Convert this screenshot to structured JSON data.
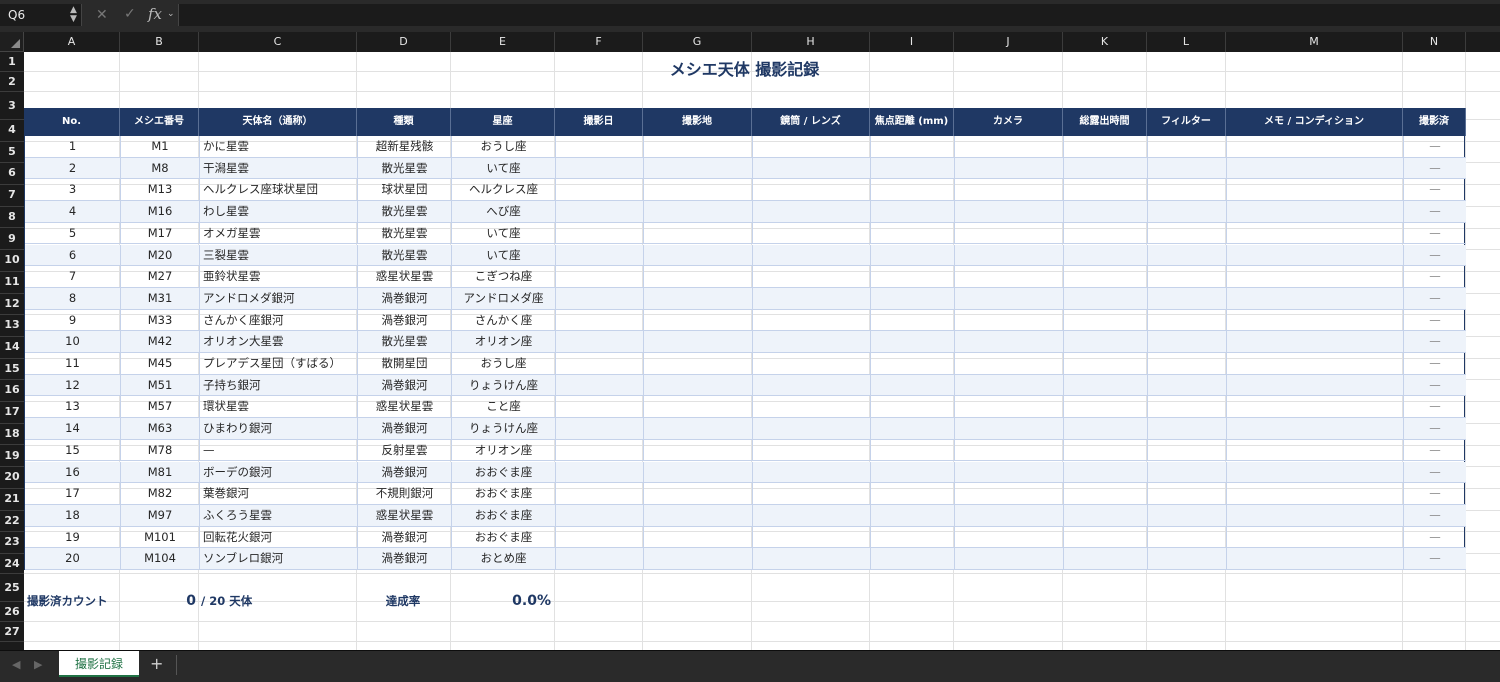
{
  "formula_bar": {
    "name_box": "Q6",
    "fx_label": "fx",
    "formula": ""
  },
  "columns": [
    "A",
    "B",
    "C",
    "D",
    "E",
    "F",
    "G",
    "H",
    "I",
    "J",
    "K",
    "L",
    "M",
    "N"
  ],
  "rows": [
    "1",
    "2",
    "3",
    "4",
    "5",
    "6",
    "7",
    "8",
    "9",
    "10",
    "11",
    "12",
    "13",
    "14",
    "15",
    "16",
    "17",
    "18",
    "19",
    "20",
    "21",
    "22",
    "23",
    "24",
    "25",
    "26",
    "27"
  ],
  "title": "メシエ天体 撮影記録",
  "headers": [
    "No.",
    "メシエ番号",
    "天体名（通称）",
    "種類",
    "星座",
    "撮影日",
    "撮影地",
    "鏡筒 / レンズ",
    "焦点距離 (mm)",
    "カメラ",
    "総露出時間",
    "フィルター",
    "メモ / コンディション",
    "撮影済"
  ],
  "records": [
    {
      "no": "1",
      "messier": "M1",
      "name": "かに星雲",
      "type": "超新星残骸",
      "constellation": "おうし座",
      "done": "—"
    },
    {
      "no": "2",
      "messier": "M8",
      "name": "干潟星雲",
      "type": "散光星雲",
      "constellation": "いて座",
      "done": "—"
    },
    {
      "no": "3",
      "messier": "M13",
      "name": "ヘルクレス座球状星団",
      "type": "球状星団",
      "constellation": "ヘルクレス座",
      "done": "—"
    },
    {
      "no": "4",
      "messier": "M16",
      "name": "わし星雲",
      "type": "散光星雲",
      "constellation": "へび座",
      "done": "—"
    },
    {
      "no": "5",
      "messier": "M17",
      "name": "オメガ星雲",
      "type": "散光星雲",
      "constellation": "いて座",
      "done": "—"
    },
    {
      "no": "6",
      "messier": "M20",
      "name": "三裂星雲",
      "type": "散光星雲",
      "constellation": "いて座",
      "done": "—"
    },
    {
      "no": "7",
      "messier": "M27",
      "name": "亜鈴状星雲",
      "type": "惑星状星雲",
      "constellation": "こぎつね座",
      "done": "—"
    },
    {
      "no": "8",
      "messier": "M31",
      "name": "アンドロメダ銀河",
      "type": "渦巻銀河",
      "constellation": "アンドロメダ座",
      "done": "—"
    },
    {
      "no": "9",
      "messier": "M33",
      "name": "さんかく座銀河",
      "type": "渦巻銀河",
      "constellation": "さんかく座",
      "done": "—"
    },
    {
      "no": "10",
      "messier": "M42",
      "name": "オリオン大星雲",
      "type": "散光星雲",
      "constellation": "オリオン座",
      "done": "—"
    },
    {
      "no": "11",
      "messier": "M45",
      "name": "プレアデス星団（すばる）",
      "type": "散開星団",
      "constellation": "おうし座",
      "done": "—"
    },
    {
      "no": "12",
      "messier": "M51",
      "name": "子持ち銀河",
      "type": "渦巻銀河",
      "constellation": "りょうけん座",
      "done": "—"
    },
    {
      "no": "13",
      "messier": "M57",
      "name": "環状星雲",
      "type": "惑星状星雲",
      "constellation": "こと座",
      "done": "—"
    },
    {
      "no": "14",
      "messier": "M63",
      "name": "ひまわり銀河",
      "type": "渦巻銀河",
      "constellation": "りょうけん座",
      "done": "—"
    },
    {
      "no": "15",
      "messier": "M78",
      "name": "—",
      "type": "反射星雲",
      "constellation": "オリオン座",
      "done": "—"
    },
    {
      "no": "16",
      "messier": "M81",
      "name": "ボーデの銀河",
      "type": "渦巻銀河",
      "constellation": "おおぐま座",
      "done": "—"
    },
    {
      "no": "17",
      "messier": "M82",
      "name": "葉巻銀河",
      "type": "不規則銀河",
      "constellation": "おおぐま座",
      "done": "—"
    },
    {
      "no": "18",
      "messier": "M97",
      "name": "ふくろう星雲",
      "type": "惑星状星雲",
      "constellation": "おおぐま座",
      "done": "—"
    },
    {
      "no": "19",
      "messier": "M101",
      "name": "回転花火銀河",
      "type": "渦巻銀河",
      "constellation": "おおぐま座",
      "done": "—"
    },
    {
      "no": "20",
      "messier": "M104",
      "name": "ソンブレロ銀河",
      "type": "渦巻銀河",
      "constellation": "おとめ座",
      "done": "—"
    }
  ],
  "summary": {
    "count_label": "撮影済カウント",
    "count_value": "0",
    "total_label": "/ 20 天体",
    "rate_label": "達成率",
    "rate_value": "0.0%"
  },
  "sheet_tabs": {
    "active": "撮影記録",
    "add": "+"
  },
  "colors": {
    "header_bg": "#1f3864",
    "alt_row": "#eef3fa",
    "tab_green": "#207245"
  }
}
